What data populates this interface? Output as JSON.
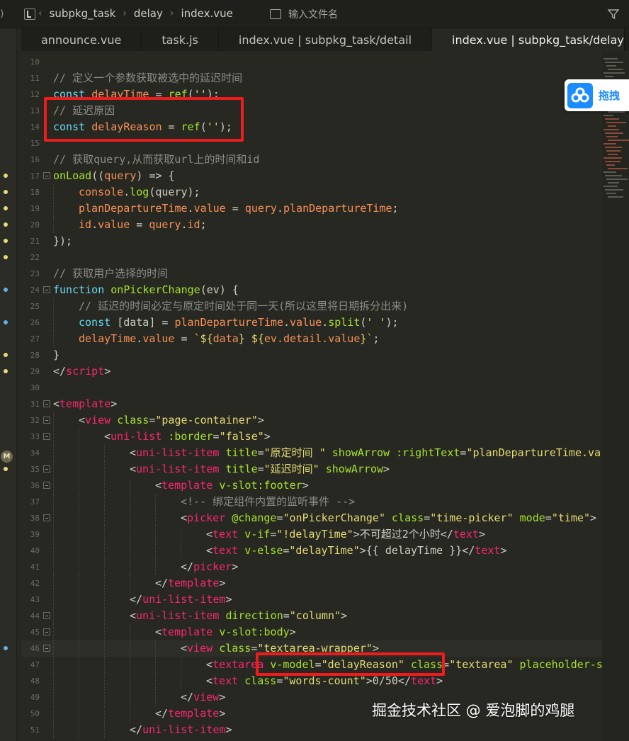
{
  "topbar": {
    "breadcrumbs": [
      "subpkg_task",
      "delay",
      "index.vue"
    ],
    "file_search_placeholder": "输入文件名"
  },
  "tabs": [
    {
      "label": "announce.vue",
      "active": false
    },
    {
      "label": "task.js",
      "active": false
    },
    {
      "label": "index.vue | subpkg_task/detail",
      "active": false
    },
    {
      "label": "index.vue | subpkg_task/delay",
      "active": true
    }
  ],
  "floating_widget": {
    "label": "拖拽",
    "icon": "cloud-icon"
  },
  "watermark": "掘金技术社区 @ 爱泡脚的鸡腿",
  "lines": [
    {
      "n": "10",
      "fold": false,
      "indent": 0,
      "parts": []
    },
    {
      "n": "11",
      "fold": false,
      "indent": 0,
      "parts": [
        [
          "c",
          "// 定义一个参数获取被选中的延迟时间"
        ]
      ]
    },
    {
      "n": "12",
      "fold": false,
      "indent": 0,
      "parts": [
        [
          "k",
          "const "
        ],
        [
          "v",
          "delayTime"
        ],
        [
          "p",
          " = "
        ],
        [
          "f",
          "ref"
        ],
        [
          "p",
          "("
        ],
        [
          "s",
          "''"
        ],
        [
          "p",
          ");"
        ]
      ]
    },
    {
      "n": "13",
      "fold": false,
      "indent": 0,
      "parts": [
        [
          "c",
          "// 延迟原因"
        ]
      ]
    },
    {
      "n": "14",
      "fold": false,
      "indent": 0,
      "parts": [
        [
          "k",
          "const "
        ],
        [
          "v",
          "delayReason"
        ],
        [
          "p",
          " = "
        ],
        [
          "f",
          "ref"
        ],
        [
          "p",
          "("
        ],
        [
          "s",
          "''"
        ],
        [
          "p",
          ");"
        ]
      ]
    },
    {
      "n": "15",
      "fold": false,
      "indent": 0,
      "parts": []
    },
    {
      "n": "16",
      "fold": false,
      "indent": 0,
      "parts": [
        [
          "c",
          "// 获取query,从而获取url上的时间和id"
        ]
      ]
    },
    {
      "n": "17",
      "fold": true,
      "indent": 0,
      "parts": [
        [
          "f",
          "onLoad"
        ],
        [
          "p",
          "(("
        ],
        [
          "v",
          "query"
        ],
        [
          "p",
          ") => {"
        ]
      ]
    },
    {
      "n": "18",
      "fold": false,
      "indent": 1,
      "parts": [
        [
          "v",
          "console"
        ],
        [
          "p",
          "."
        ],
        [
          "f",
          "log"
        ],
        [
          "p",
          "(query);"
        ]
      ]
    },
    {
      "n": "19",
      "fold": false,
      "indent": 1,
      "parts": [
        [
          "v",
          "planDepartureTime"
        ],
        [
          "p",
          "."
        ],
        [
          "v",
          "value"
        ],
        [
          "p",
          " = "
        ],
        [
          "v",
          "query"
        ],
        [
          "p",
          "."
        ],
        [
          "v",
          "planDepartureTime"
        ],
        [
          "p",
          ";"
        ]
      ]
    },
    {
      "n": "20",
      "fold": false,
      "indent": 1,
      "parts": [
        [
          "v",
          "id"
        ],
        [
          "p",
          "."
        ],
        [
          "v",
          "value"
        ],
        [
          "p",
          " = "
        ],
        [
          "v",
          "query"
        ],
        [
          "p",
          "."
        ],
        [
          "v",
          "id"
        ],
        [
          "p",
          ";"
        ]
      ]
    },
    {
      "n": "21",
      "fold": false,
      "indent": 0,
      "parts": [
        [
          "p",
          "});"
        ]
      ]
    },
    {
      "n": "22",
      "fold": false,
      "indent": 0,
      "parts": []
    },
    {
      "n": "23",
      "fold": false,
      "indent": 0,
      "parts": [
        [
          "c",
          "// 获取用户选择的时间"
        ]
      ]
    },
    {
      "n": "24",
      "fold": true,
      "indent": 0,
      "parts": [
        [
          "k",
          "function "
        ],
        [
          "f",
          "onPickerChange"
        ],
        [
          "p",
          "(ev) {"
        ]
      ]
    },
    {
      "n": "25",
      "fold": false,
      "indent": 1,
      "parts": [
        [
          "c",
          "// 延迟的时间必定与原定时间处于同一天(所以这里将日期拆分出来)"
        ]
      ]
    },
    {
      "n": "26",
      "fold": false,
      "indent": 1,
      "parts": [
        [
          "k",
          "const "
        ],
        [
          "p",
          "[data] = "
        ],
        [
          "v",
          "planDepartureTime"
        ],
        [
          "p",
          "."
        ],
        [
          "v",
          "value"
        ],
        [
          "p",
          "."
        ],
        [
          "f",
          "split"
        ],
        [
          "p",
          "("
        ],
        [
          "s",
          "' '"
        ],
        [
          "p",
          ");"
        ]
      ]
    },
    {
      "n": "27",
      "fold": false,
      "indent": 1,
      "parts": [
        [
          "v",
          "delayTime"
        ],
        [
          "p",
          "."
        ],
        [
          "v",
          "value"
        ],
        [
          "p",
          " = "
        ],
        [
          "s",
          "`${"
        ],
        [
          "v",
          "data"
        ],
        [
          "s",
          "} ${"
        ],
        [
          "v",
          "ev.detail.value"
        ],
        [
          "s",
          "}`"
        ],
        [
          "p",
          ";"
        ]
      ]
    },
    {
      "n": "28",
      "fold": false,
      "indent": 0,
      "parts": [
        [
          "p",
          "}"
        ]
      ]
    },
    {
      "n": "29",
      "fold": false,
      "indent": 0,
      "parts": [
        [
          "p",
          "</"
        ],
        [
          "t",
          "script"
        ],
        [
          "p",
          ">"
        ]
      ]
    },
    {
      "n": "30",
      "fold": false,
      "indent": 0,
      "parts": []
    },
    {
      "n": "31",
      "fold": true,
      "indent": 0,
      "parts": [
        [
          "p",
          "<"
        ],
        [
          "t",
          "template"
        ],
        [
          "p",
          ">"
        ]
      ]
    },
    {
      "n": "32",
      "fold": true,
      "indent": 1,
      "parts": [
        [
          "p",
          "<"
        ],
        [
          "t",
          "view "
        ],
        [
          "a",
          "class"
        ],
        [
          "p",
          "="
        ],
        [
          "s",
          "\"page-container\""
        ],
        [
          "p",
          ">"
        ]
      ]
    },
    {
      "n": "33",
      "fold": true,
      "indent": 2,
      "parts": [
        [
          "p",
          "<"
        ],
        [
          "t",
          "uni-list "
        ],
        [
          "a",
          ":border"
        ],
        [
          "p",
          "="
        ],
        [
          "s",
          "\"false\""
        ],
        [
          "p",
          ">"
        ]
      ]
    },
    {
      "n": "34",
      "fold": false,
      "indent": 3,
      "parts": [
        [
          "p",
          "<"
        ],
        [
          "t",
          "uni-list-item "
        ],
        [
          "a",
          "title"
        ],
        [
          "p",
          "="
        ],
        [
          "s",
          "\"原定时间 \" "
        ],
        [
          "a",
          "showArrow "
        ],
        [
          "a",
          ":rightText"
        ],
        [
          "p",
          "="
        ],
        [
          "s",
          "\"planDepartureTime.va"
        ]
      ]
    },
    {
      "n": "35",
      "fold": true,
      "indent": 3,
      "parts": [
        [
          "p",
          "<"
        ],
        [
          "t",
          "uni-list-item "
        ],
        [
          "a",
          "title"
        ],
        [
          "p",
          "="
        ],
        [
          "s",
          "\"延迟时间\" "
        ],
        [
          "a",
          "showArrow"
        ],
        [
          "p",
          ">"
        ]
      ]
    },
    {
      "n": "36",
      "fold": true,
      "indent": 4,
      "parts": [
        [
          "p",
          "<"
        ],
        [
          "t",
          "template "
        ],
        [
          "a",
          "v-slot:footer"
        ],
        [
          "p",
          ">"
        ]
      ]
    },
    {
      "n": "37",
      "fold": false,
      "indent": 5,
      "parts": [
        [
          "c",
          "<!-- 绑定组件内置的监听事件 -->"
        ]
      ]
    },
    {
      "n": "38",
      "fold": true,
      "indent": 5,
      "parts": [
        [
          "p",
          "<"
        ],
        [
          "t",
          "picker "
        ],
        [
          "a",
          "@change"
        ],
        [
          "p",
          "="
        ],
        [
          "s",
          "\"onPickerChange\" "
        ],
        [
          "a",
          "class"
        ],
        [
          "p",
          "="
        ],
        [
          "s",
          "\"time-picker\" "
        ],
        [
          "a",
          "mode"
        ],
        [
          "p",
          "="
        ],
        [
          "s",
          "\"time\""
        ],
        [
          "p",
          ">"
        ]
      ]
    },
    {
      "n": "39",
      "fold": false,
      "indent": 6,
      "parts": [
        [
          "p",
          "<"
        ],
        [
          "t",
          "text "
        ],
        [
          "a",
          "v-if"
        ],
        [
          "p",
          "="
        ],
        [
          "s",
          "\"!delayTime\""
        ],
        [
          "p",
          ">不可超过2个小时</"
        ],
        [
          "t",
          "text"
        ],
        [
          "p",
          ">"
        ]
      ]
    },
    {
      "n": "40",
      "fold": false,
      "indent": 6,
      "parts": [
        [
          "p",
          "<"
        ],
        [
          "t",
          "text "
        ],
        [
          "a",
          "v-else"
        ],
        [
          "p",
          "="
        ],
        [
          "s",
          "\"delayTime\""
        ],
        [
          "p",
          ">{{ delayTime }}</"
        ],
        [
          "t",
          "text"
        ],
        [
          "p",
          ">"
        ]
      ]
    },
    {
      "n": "41",
      "fold": false,
      "indent": 5,
      "parts": [
        [
          "p",
          "</"
        ],
        [
          "t",
          "picker"
        ],
        [
          "p",
          ">"
        ]
      ]
    },
    {
      "n": "42",
      "fold": false,
      "indent": 4,
      "parts": [
        [
          "p",
          "</"
        ],
        [
          "t",
          "template"
        ],
        [
          "p",
          ">"
        ]
      ]
    },
    {
      "n": "43",
      "fold": false,
      "indent": 3,
      "parts": [
        [
          "p",
          "</"
        ],
        [
          "t",
          "uni-list-item"
        ],
        [
          "p",
          ">"
        ]
      ]
    },
    {
      "n": "44",
      "fold": true,
      "indent": 3,
      "parts": [
        [
          "p",
          "<"
        ],
        [
          "t",
          "uni-list-item "
        ],
        [
          "a",
          "direction"
        ],
        [
          "p",
          "="
        ],
        [
          "s",
          "\"column\""
        ],
        [
          "p",
          ">"
        ]
      ]
    },
    {
      "n": "45",
      "fold": true,
      "indent": 4,
      "parts": [
        [
          "p",
          "<"
        ],
        [
          "t",
          "template "
        ],
        [
          "a",
          "v-slot:body"
        ],
        [
          "p",
          ">"
        ]
      ]
    },
    {
      "n": "46",
      "fold": true,
      "indent": 5,
      "parts": [
        [
          "p",
          "<"
        ],
        [
          "t",
          "view "
        ],
        [
          "a",
          "class"
        ],
        [
          "p",
          "="
        ],
        [
          "s",
          "\"textarea-wrapper\""
        ],
        [
          "p",
          ">"
        ]
      ]
    },
    {
      "n": "47",
      "fold": false,
      "indent": 6,
      "parts": [
        [
          "p",
          "<"
        ],
        [
          "t",
          "textarea "
        ],
        [
          "a",
          "v-model"
        ],
        [
          "p",
          "="
        ],
        [
          "s",
          "\"delayReason\" "
        ],
        [
          "a",
          "class"
        ],
        [
          "p",
          "="
        ],
        [
          "s",
          "\"textarea\" "
        ],
        [
          "a",
          "placeholder-s"
        ]
      ]
    },
    {
      "n": "48",
      "fold": false,
      "indent": 6,
      "parts": [
        [
          "p",
          "<"
        ],
        [
          "t",
          "text "
        ],
        [
          "a",
          "class"
        ],
        [
          "p",
          "="
        ],
        [
          "s",
          "\"words-count\""
        ],
        [
          "p",
          ">0/50</"
        ],
        [
          "t",
          "text"
        ],
        [
          "p",
          ">"
        ]
      ]
    },
    {
      "n": "49",
      "fold": false,
      "indent": 5,
      "parts": [
        [
          "p",
          "</"
        ],
        [
          "t",
          "view"
        ],
        [
          "p",
          ">"
        ]
      ]
    },
    {
      "n": "50",
      "fold": false,
      "indent": 4,
      "parts": [
        [
          "p",
          "</"
        ],
        [
          "t",
          "template"
        ],
        [
          "p",
          ">"
        ]
      ]
    },
    {
      "n": "51",
      "fold": false,
      "indent": 3,
      "parts": [
        [
          "p",
          "</"
        ],
        [
          "t",
          "uni-list-item"
        ],
        [
          "p",
          ">"
        ]
      ]
    }
  ],
  "gutter_markers": [
    {
      "line": "17",
      "color": "#e6db74"
    },
    {
      "line": "18",
      "color": "#e6db74"
    },
    {
      "line": "19",
      "color": "#e6db74"
    },
    {
      "line": "20",
      "color": "#e6db74"
    },
    {
      "line": "21",
      "color": "#e6db74"
    },
    {
      "line": "22",
      "color": "#e6db74"
    },
    {
      "line": "24",
      "color": "#5fb3e8"
    },
    {
      "line": "26",
      "color": "#5fb3e8"
    },
    {
      "line": "28",
      "color": "#e6db74"
    },
    {
      "line": "29",
      "color": "#e6db74"
    },
    {
      "line": "35",
      "color": "#e6db74"
    },
    {
      "line": "46",
      "color": "#5fb3e8"
    }
  ],
  "gutter_badge": "M"
}
